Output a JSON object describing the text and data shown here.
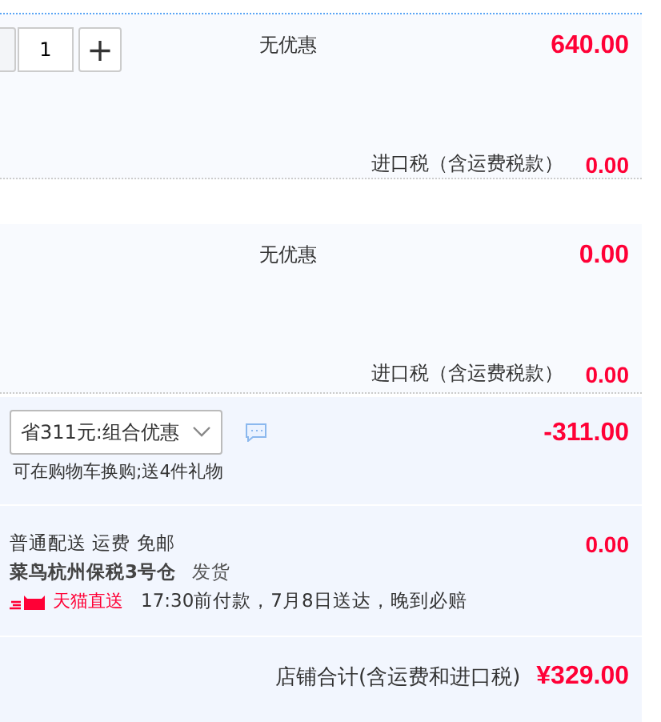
{
  "items": [
    {
      "quantity": {
        "value": "1",
        "plus": "+"
      },
      "discount": "无优惠",
      "price": "640.00",
      "tax_label": "进口税（含运费税款）",
      "tax": "0.00"
    },
    {
      "discount": "无优惠",
      "price": "0.00",
      "tax_label": "进口税（含运费税款）",
      "tax": "0.00"
    }
  ],
  "promotion": {
    "select": "省311元:组合优惠",
    "note": "可在购物车换购;送4件礼物",
    "amount": "-311.00"
  },
  "delivery": {
    "method": "普通配送 运费 免邮",
    "warehouse": "菜鸟杭州保税3号仓",
    "ship": "发货",
    "badge": "天猫直送",
    "promise": "17:30前付款，7月8日送达，晚到必赔",
    "fee": "0.00"
  },
  "total": {
    "label": "店铺合计(含运费和进口税)",
    "amount": "¥329.00"
  }
}
